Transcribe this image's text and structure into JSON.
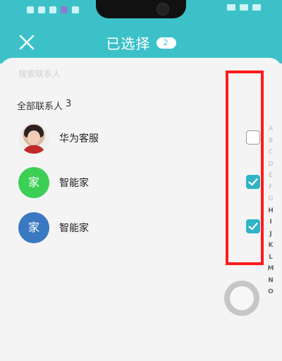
{
  "header": {
    "title": "已选择",
    "selected_count": "2"
  },
  "search": {
    "placeholder": "搜索联系人"
  },
  "section": {
    "label": "全部联系人",
    "count": "3"
  },
  "contacts": [
    {
      "name": "华为客服",
      "avatar_text": "",
      "avatar_color": "#e9e1dc",
      "checked": false
    },
    {
      "name": "智能家",
      "avatar_text": "家",
      "avatar_color": "#3ccf55",
      "checked": true
    },
    {
      "name": "智能家",
      "avatar_text": "家",
      "avatar_color": "#3a78c2",
      "checked": true
    }
  ],
  "index_letters": [
    "A",
    "B",
    "C",
    "D",
    "E",
    "F",
    "G",
    "H",
    "I",
    "J",
    "K",
    "L",
    "M",
    "N",
    "O"
  ],
  "colors": {
    "accent": "#3cc1c9",
    "checkbox_checked": "#2fb3c7",
    "highlight": "#ff1a1a"
  }
}
